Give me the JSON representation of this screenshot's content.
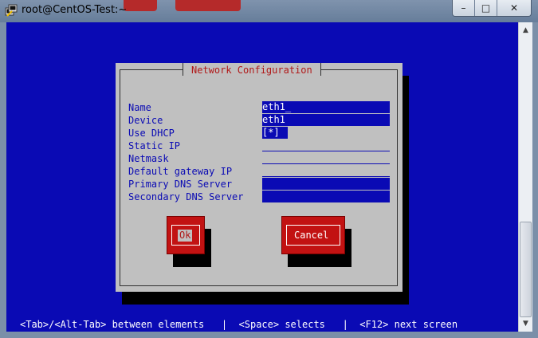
{
  "window": {
    "title": "root@CentOS-Test:~",
    "controls": {
      "minimize": "minimize-icon",
      "maximize": "maximize-icon",
      "close": "close-icon"
    }
  },
  "dialog": {
    "title": "Network Configuration",
    "fields": [
      {
        "label": "Name",
        "value": "eth1_"
      },
      {
        "label": "Device",
        "value": "eth1"
      },
      {
        "label": "Use DHCP",
        "value": "[*]"
      },
      {
        "label": "Static IP",
        "value": ""
      },
      {
        "label": "Netmask",
        "value": ""
      },
      {
        "label": "Default gateway IP",
        "value": ""
      },
      {
        "label": "Primary DNS Server",
        "value": ""
      },
      {
        "label": "Secondary DNS Server",
        "value": ""
      }
    ],
    "buttons": {
      "ok": "Ok",
      "cancel": "Cancel"
    }
  },
  "help_line": "<Tab>/<Alt-Tab> between elements   |  <Space> selects   |  <F12> next screen",
  "colors": {
    "terminal_bg": "#0a0ab4",
    "dialog_bg": "#c0c0c0",
    "accent_red": "#c21212",
    "title_red": "#b01818"
  }
}
